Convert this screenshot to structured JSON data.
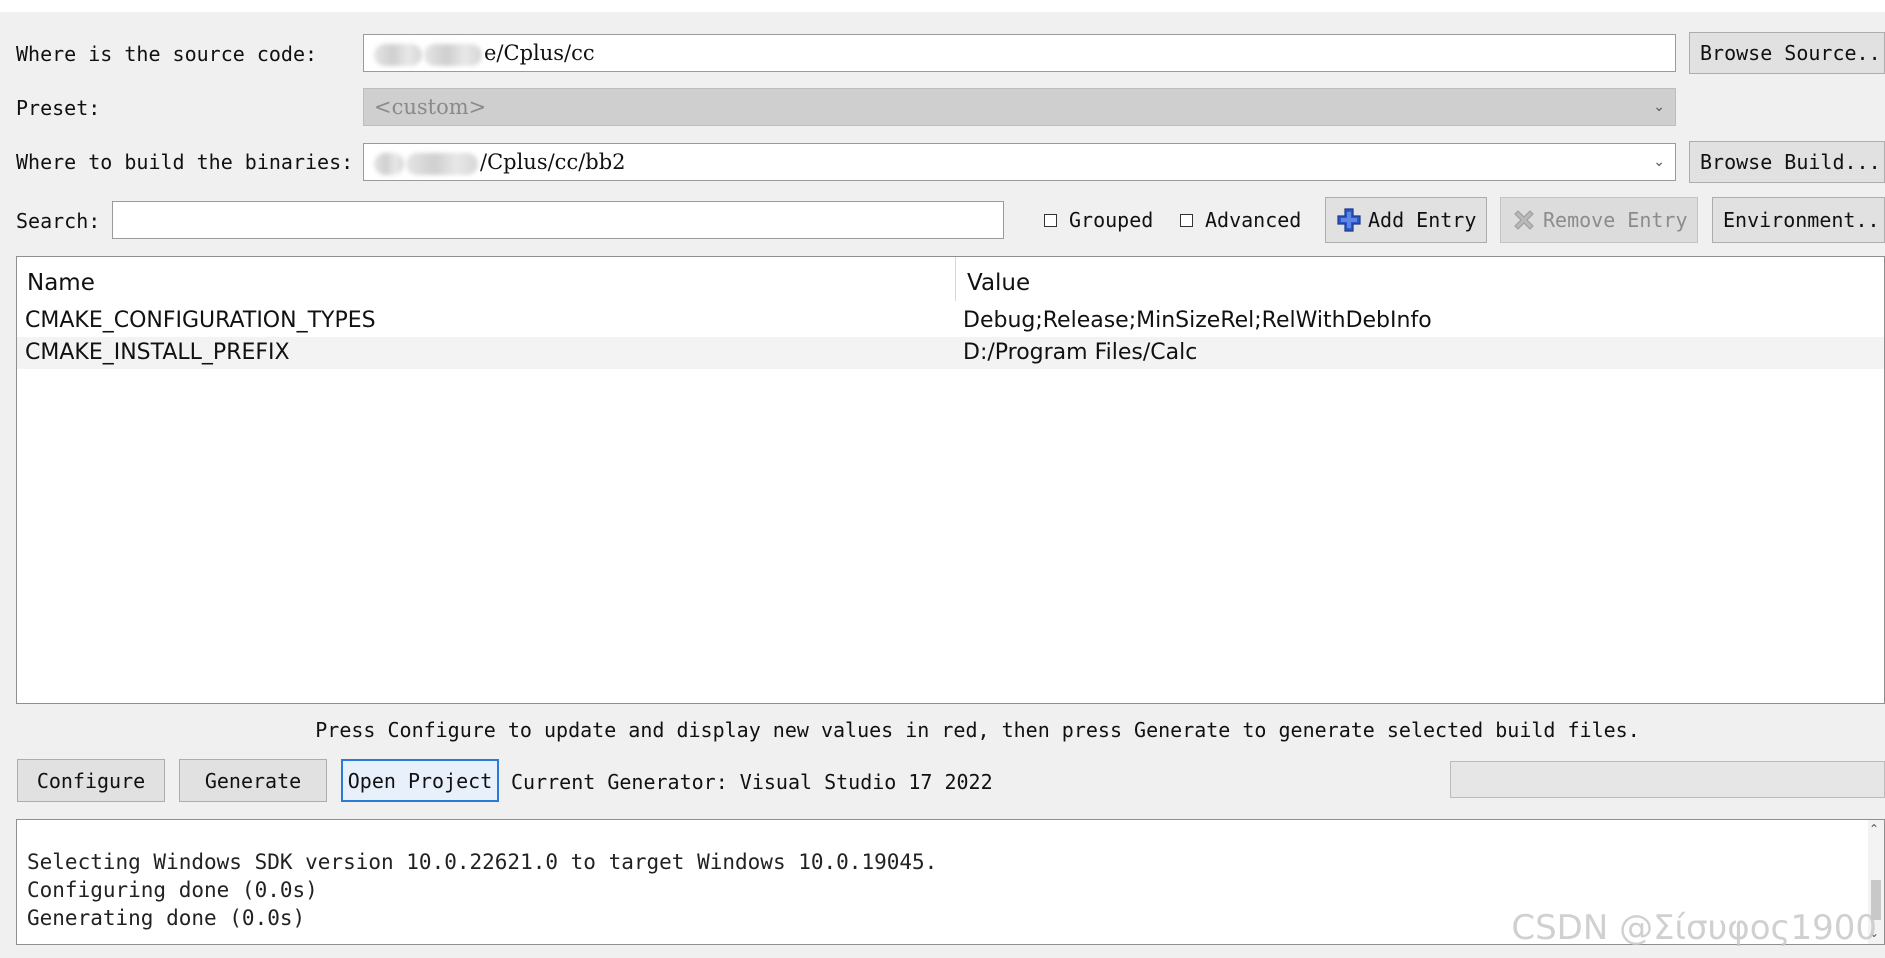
{
  "source": {
    "label": "Where is the source code:",
    "value_suffix": "e/Cplus/cc",
    "button": "Browse Source..."
  },
  "preset": {
    "label": "Preset:",
    "value": "<custom>"
  },
  "build": {
    "label": "Where to build the binaries:",
    "value_suffix": "/Cplus/cc/bb2",
    "button": "Browse Build..."
  },
  "search": {
    "label": "Search:",
    "value": ""
  },
  "options": {
    "grouped": "Grouped",
    "advanced": "Advanced"
  },
  "toolbar": {
    "add_entry": "Add Entry",
    "remove_entry": "Remove Entry",
    "environment": "Environment..."
  },
  "table": {
    "headers": [
      "Name",
      "Value"
    ],
    "rows": [
      {
        "name": "CMAKE_CONFIGURATION_TYPES",
        "value": "Debug;Release;MinSizeRel;RelWithDebInfo"
      },
      {
        "name": "CMAKE_INSTALL_PREFIX",
        "value": "D:/Program Files/Calc"
      }
    ]
  },
  "hint": "Press Configure to update and display new values in red, then press Generate to generate selected build files.",
  "actions": {
    "configure": "Configure",
    "generate": "Generate",
    "open_project": "Open Project",
    "current_generator": "Current Generator: Visual Studio 17 2022"
  },
  "log": [
    "Selecting Windows SDK version 10.0.22621.0 to target Windows 10.0.19045.",
    "Configuring done (0.0s)",
    "Generating done (0.0s)"
  ],
  "watermark": "CSDN @Σίσυφος1900",
  "colors": {
    "background": "#f0f0f0",
    "add_icon": "#2b57c9",
    "focus": "#2a7ad6"
  }
}
